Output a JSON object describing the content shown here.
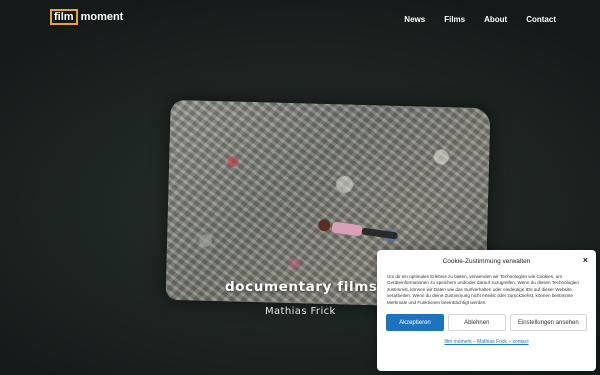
{
  "header": {
    "logo_boxed": "film",
    "logo_text": "moment",
    "nav": [
      "News",
      "Films",
      "About",
      "Contact"
    ]
  },
  "hero": {
    "title": "documentary films",
    "subtitle": "Mathias Frick"
  },
  "cookie": {
    "title": "Cookie-Zustimmung verwalten",
    "close": "×",
    "text": "Um dir ein optimales Erlebnis zu bieten, verwenden wir Technologien wie Cookies, um Geräteinformationen zu speichern und/oder darauf zuzugreifen. Wenn du diesen Technologien zustimmst, können wir Daten wie das Surfverhalten oder eindeutige IDs auf dieser Website verarbeiten. Wenn du deine Zustimmung nicht erteilst oder zurückziehst, können bestimmte Merkmale und Funktionen beeinträchtigt werden.",
    "accept": "Akzeptieren",
    "deny": "Ablehnen",
    "settings": "Einstellungen ansehen",
    "links": [
      "film moment – Mathias Frick – contact"
    ]
  },
  "colors": {
    "accent_logo": "#e8a33a",
    "accept_button": "#1e73be"
  }
}
